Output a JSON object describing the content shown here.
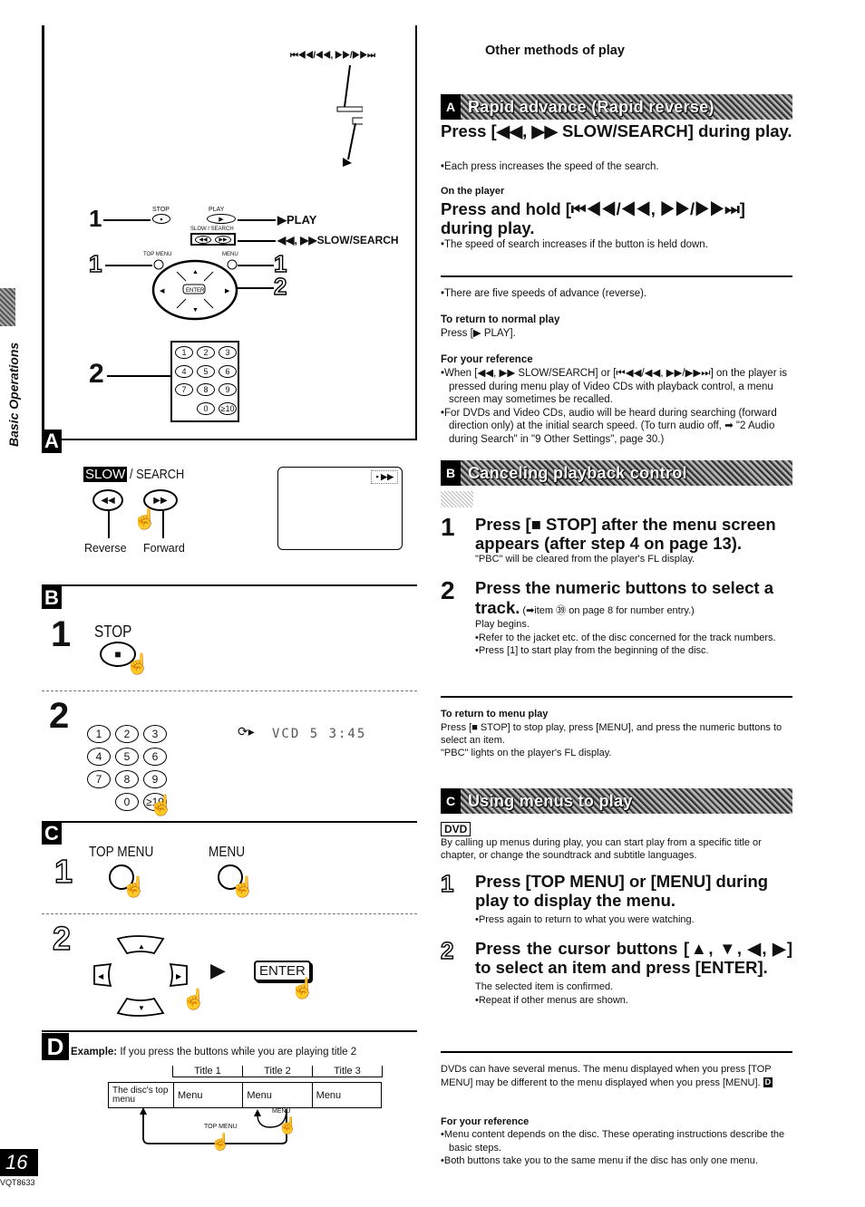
{
  "page": {
    "side_label": "Basic Operations",
    "page_number": "16",
    "doc_code": "VQT8633"
  },
  "left": {
    "player_diagram": {
      "skip_search_label": "⏮◀◀/◀◀, ▶▶/▶▶⏭",
      "play_arrow": "▶"
    },
    "remote_diagram": {
      "stop_small": "STOP",
      "play_small": "PLAY",
      "slow_search_small": "SLOW / SEARCH",
      "top_menu_small": "TOP MENU",
      "menu_small": "MENU",
      "enter_small": "ENTER",
      "callout_play": "▶PLAY",
      "callout_slow_search": "◀◀, ▶▶SLOW/SEARCH",
      "callout_1a": "1",
      "callout_1b": "1",
      "callout_1c": "1",
      "callout_2a": "2",
      "callout_2b": "2",
      "numeric_keys": [
        "1",
        "2",
        "3",
        "4",
        "5",
        "6",
        "7",
        "8",
        "9",
        "0",
        "≥10"
      ]
    },
    "section_a": {
      "badge": "A",
      "slow_tag": "SLOW",
      "search_label": "/ SEARCH",
      "reverse_label": "Reverse",
      "forward_label": "Forward",
      "rev_key": "◀◀",
      "fwd_key": "▶▶",
      "screen_indicator": "▪ ▶▶"
    },
    "section_b": {
      "badge": "B",
      "step1_num": "1",
      "stop_label": "STOP",
      "step2_num": "2",
      "numeric_keys": [
        "1",
        "2",
        "3",
        "4",
        "5",
        "6",
        "7",
        "8",
        "9",
        "0",
        "≥10"
      ],
      "fl_display": "VCD  5   3:45"
    },
    "section_c": {
      "badge": "C",
      "step1_num": "1",
      "top_menu_label": "TOP MENU",
      "menu_label": "MENU",
      "step2_num": "2",
      "enter_label": "ENTER",
      "arrow": "▶"
    },
    "section_d": {
      "badge": "D",
      "example_label": "Example:",
      "example_text": " If you press the buttons while you are playing title 2",
      "titles": [
        "Title 1",
        "Title 2",
        "Title 3"
      ],
      "top_menu_cell": "The disc's top menu",
      "menu_cells": [
        "Menu",
        "Menu",
        "Menu"
      ],
      "top_menu_arrow_label": "TOP MENU",
      "menu_arrow_label": "MENU"
    }
  },
  "right": {
    "heading": "Other methods of play",
    "section_a": {
      "letter": "A",
      "title": "Rapid advance (Rapid reverse)",
      "step_heading": "Press [◀◀, ▶▶ SLOW/SEARCH] during play.",
      "step_note": "•Each press increases the speed of the search.",
      "on_player_label": "On the player",
      "player_heading": "Press and hold [⏮◀◀/◀◀, ▶▶/▶▶⏭] during play.",
      "player_note": "•The speed of search increases if the button is held down.",
      "speeds_note": "•There are five speeds of advance (reverse).",
      "return_heading": "To return to normal play",
      "return_text": "Press [▶ PLAY].",
      "reference_heading": "For your reference",
      "reference_items": [
        "•When [◀◀, ▶▶ SLOW/SEARCH] or [⏮◀◀/◀◀, ▶▶/▶▶⏭] on the player is pressed during menu play of Video CDs with playback control, a menu screen may sometimes be recalled.",
        "•For DVDs and Video CDs, audio will be heard during searching (forward direction only) at the initial search speed. (To turn audio off, ➡ \"2 Audio during Search\" in \"9 Other Settings\", page 30.)"
      ]
    },
    "section_b": {
      "letter": "B",
      "title": "Canceling playback control",
      "steps": [
        {
          "num": "1",
          "heading": "Press [■ STOP] after the menu screen appears (after step 4 on page 13).",
          "notes": [
            "\"PBC\" will be cleared from the player's FL display."
          ]
        },
        {
          "num": "2",
          "heading": "Press the numeric buttons to select a track.",
          "heading_ref": " (➡item ㊴ on page 8 for number entry.)",
          "notes": [
            "Play begins.",
            "•Refer to the jacket etc. of the disc concerned for the track numbers.",
            "•Press [1] to start play from the beginning of the disc."
          ]
        }
      ],
      "return_heading": "To return to menu play",
      "return_lines": [
        "Press [■ STOP] to stop play, press [MENU], and press the numeric buttons to select an item.",
        "\"PBC\" lights on the player's FL display."
      ]
    },
    "section_c": {
      "letter": "C",
      "title": "Using menus to play",
      "disc_badge": "DVD",
      "intro": "By calling up menus during play, you can start play from a specific title or chapter, or change the soundtrack and subtitle languages.",
      "steps": [
        {
          "num": "1",
          "heading": "Press [TOP MENU] or [MENU] during play to display the menu.",
          "notes": [
            "•Press again to return to what you were watching."
          ]
        },
        {
          "num": "2",
          "heading": "Press the cursor buttons [▲, ▼, ◀, ▶] to select an item and press [ENTER].",
          "notes": [
            "The selected item is confirmed.",
            "•Repeat if other menus are shown."
          ]
        }
      ],
      "menus_note": "DVDs can have several menus. The menu displayed when you press [TOP MENU] may be different to the menu displayed when you press [MENU].",
      "menus_note_badge": "D",
      "reference_heading": "For your reference",
      "reference_items": [
        "•Menu content depends on the disc. These operating instructions describe the basic steps.",
        "•Both buttons take you to the same menu if the disc has only one menu."
      ]
    }
  }
}
